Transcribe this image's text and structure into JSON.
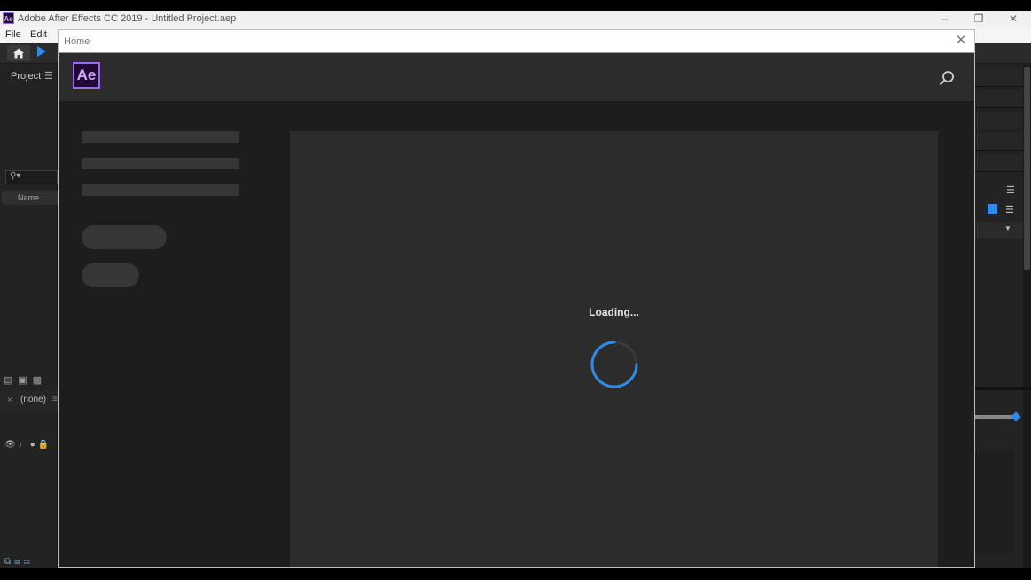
{
  "window": {
    "title": "Adobe After Effects CC 2019 - Untitled Project.aep",
    "app_icon": "Ae"
  },
  "menu": {
    "items": [
      "File",
      "Edit"
    ]
  },
  "project_panel": {
    "title": "Project",
    "column_header": "Name"
  },
  "timeline_panel": {
    "tab_label": "(none)"
  },
  "home": {
    "title": "Home",
    "logo": "Ae",
    "loading_text": "Loading...",
    "accent_color": "#9c6be6",
    "spinner_color": "#2d8ceb"
  },
  "icons": {
    "search": "search-icon",
    "close": "close-icon",
    "home": "home-icon",
    "selection_tool": "selection-tool-icon"
  }
}
